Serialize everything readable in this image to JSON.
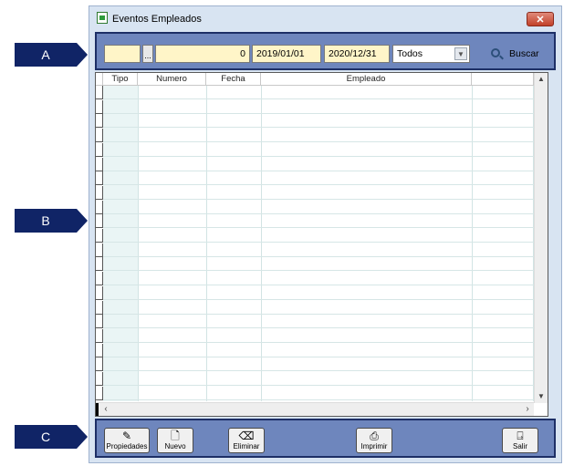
{
  "window": {
    "title": "Eventos Empleados",
    "close_glyph": "✕"
  },
  "callouts": [
    "A",
    "B",
    "C"
  ],
  "filter": {
    "code_value": "",
    "ellipsis_label": "...",
    "number_value": "0",
    "date_from": "2019/01/01",
    "date_to": "2020/12/31",
    "type_selected": "Todos",
    "search_label": "Buscar"
  },
  "grid": {
    "columns": [
      "Tipo",
      "Numero",
      "Fecha",
      "Empleado",
      ""
    ],
    "row_count": 22
  },
  "toolbar": {
    "buttons": [
      {
        "label": "Propiedades",
        "icon": "properties-icon",
        "glyph": "✎"
      },
      {
        "label": "Nuevo",
        "icon": "new-document-icon",
        "glyph": "🗋"
      },
      {
        "label": "Eliminar",
        "icon": "eraser-icon",
        "glyph": "⌫"
      },
      {
        "label": "Imprimir",
        "icon": "printer-icon",
        "glyph": "⎙"
      },
      {
        "label": "Salir",
        "icon": "exit-door-icon",
        "glyph": "⍈"
      }
    ]
  },
  "colors": {
    "panel": "#6e86bd",
    "panel_border": "#1d2f66",
    "callout": "#102466",
    "field_bg": "#fff5c8",
    "window_bg": "#d8e4f2"
  }
}
